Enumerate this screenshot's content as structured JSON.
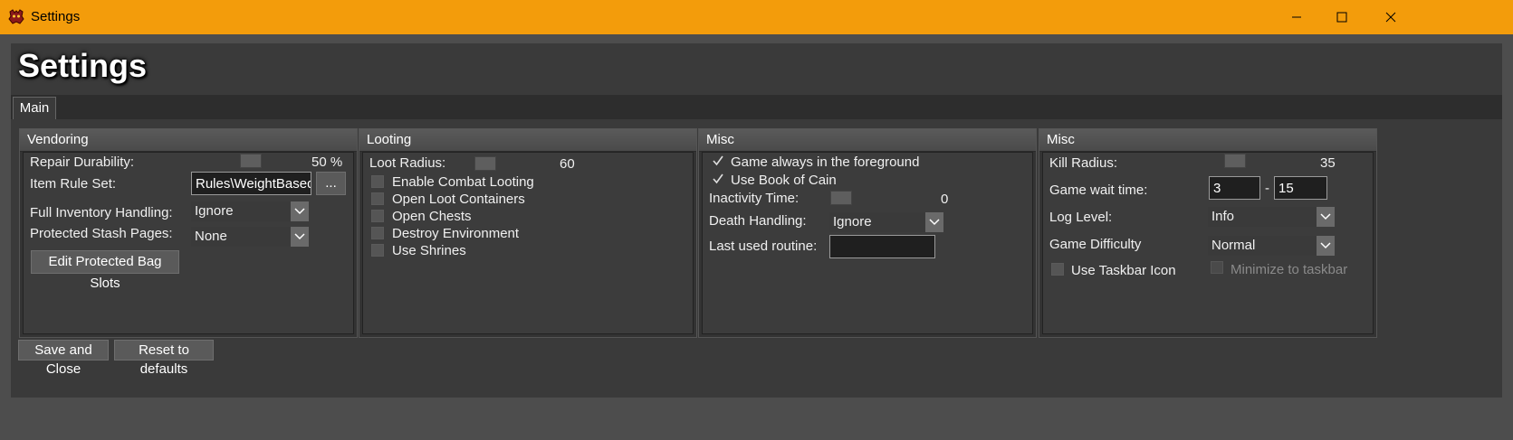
{
  "titlebar": {
    "title": "Settings"
  },
  "header": {
    "title": "Settings"
  },
  "tabs": [
    {
      "label": "Main"
    }
  ],
  "vendoring": {
    "title": "Vendoring",
    "repair_label": "Repair Durability:",
    "repair_value": "50 %",
    "item_rule_label": "Item Rule Set:",
    "item_rule_value": "Rules\\WeightBasedF",
    "browse_label": "...",
    "full_inv_label": "Full Inventory Handling:",
    "full_inv_value": "Ignore",
    "stash_label": "Protected Stash Pages:",
    "stash_value": "None",
    "edit_bag_label": "Edit Protected Bag Slots"
  },
  "looting": {
    "title": "Looting",
    "radius_label": "Loot Radius:",
    "radius_value": "60",
    "options": [
      {
        "label": "Enable Combat Looting",
        "checked": false
      },
      {
        "label": "Open Loot Containers",
        "checked": false
      },
      {
        "label": "Open Chests",
        "checked": false
      },
      {
        "label": "Destroy Environment",
        "checked": false
      },
      {
        "label": "Use Shrines",
        "checked": false
      }
    ]
  },
  "misc1": {
    "title": "Misc",
    "foreground_label": "Game always in the foreground",
    "foreground_checked": true,
    "cain_label": "Use Book of Cain",
    "cain_checked": true,
    "inactivity_label": "Inactivity Time:",
    "inactivity_value": "0",
    "death_label": "Death Handling:",
    "death_value": "Ignore",
    "routine_label": "Last used routine:",
    "routine_value": ""
  },
  "misc2": {
    "title": "Misc",
    "kill_label": "Kill Radius:",
    "kill_value": "35",
    "wait_label": "Game wait time:",
    "wait_min": "3",
    "wait_sep": "-",
    "wait_max": "15",
    "log_label": "Log Level:",
    "log_value": "Info",
    "difficulty_label": "Game Difficulty",
    "difficulty_value": "Normal",
    "taskbar_label": "Use Taskbar Icon",
    "taskbar_checked": false,
    "minimize_label": "Minimize to taskbar",
    "minimize_checked": false
  },
  "footer": {
    "save_label": "Save and Close",
    "reset_label": "Reset to defaults"
  },
  "colors": {
    "titlebar": "#f39c0b",
    "background": "#3a3a3a"
  }
}
